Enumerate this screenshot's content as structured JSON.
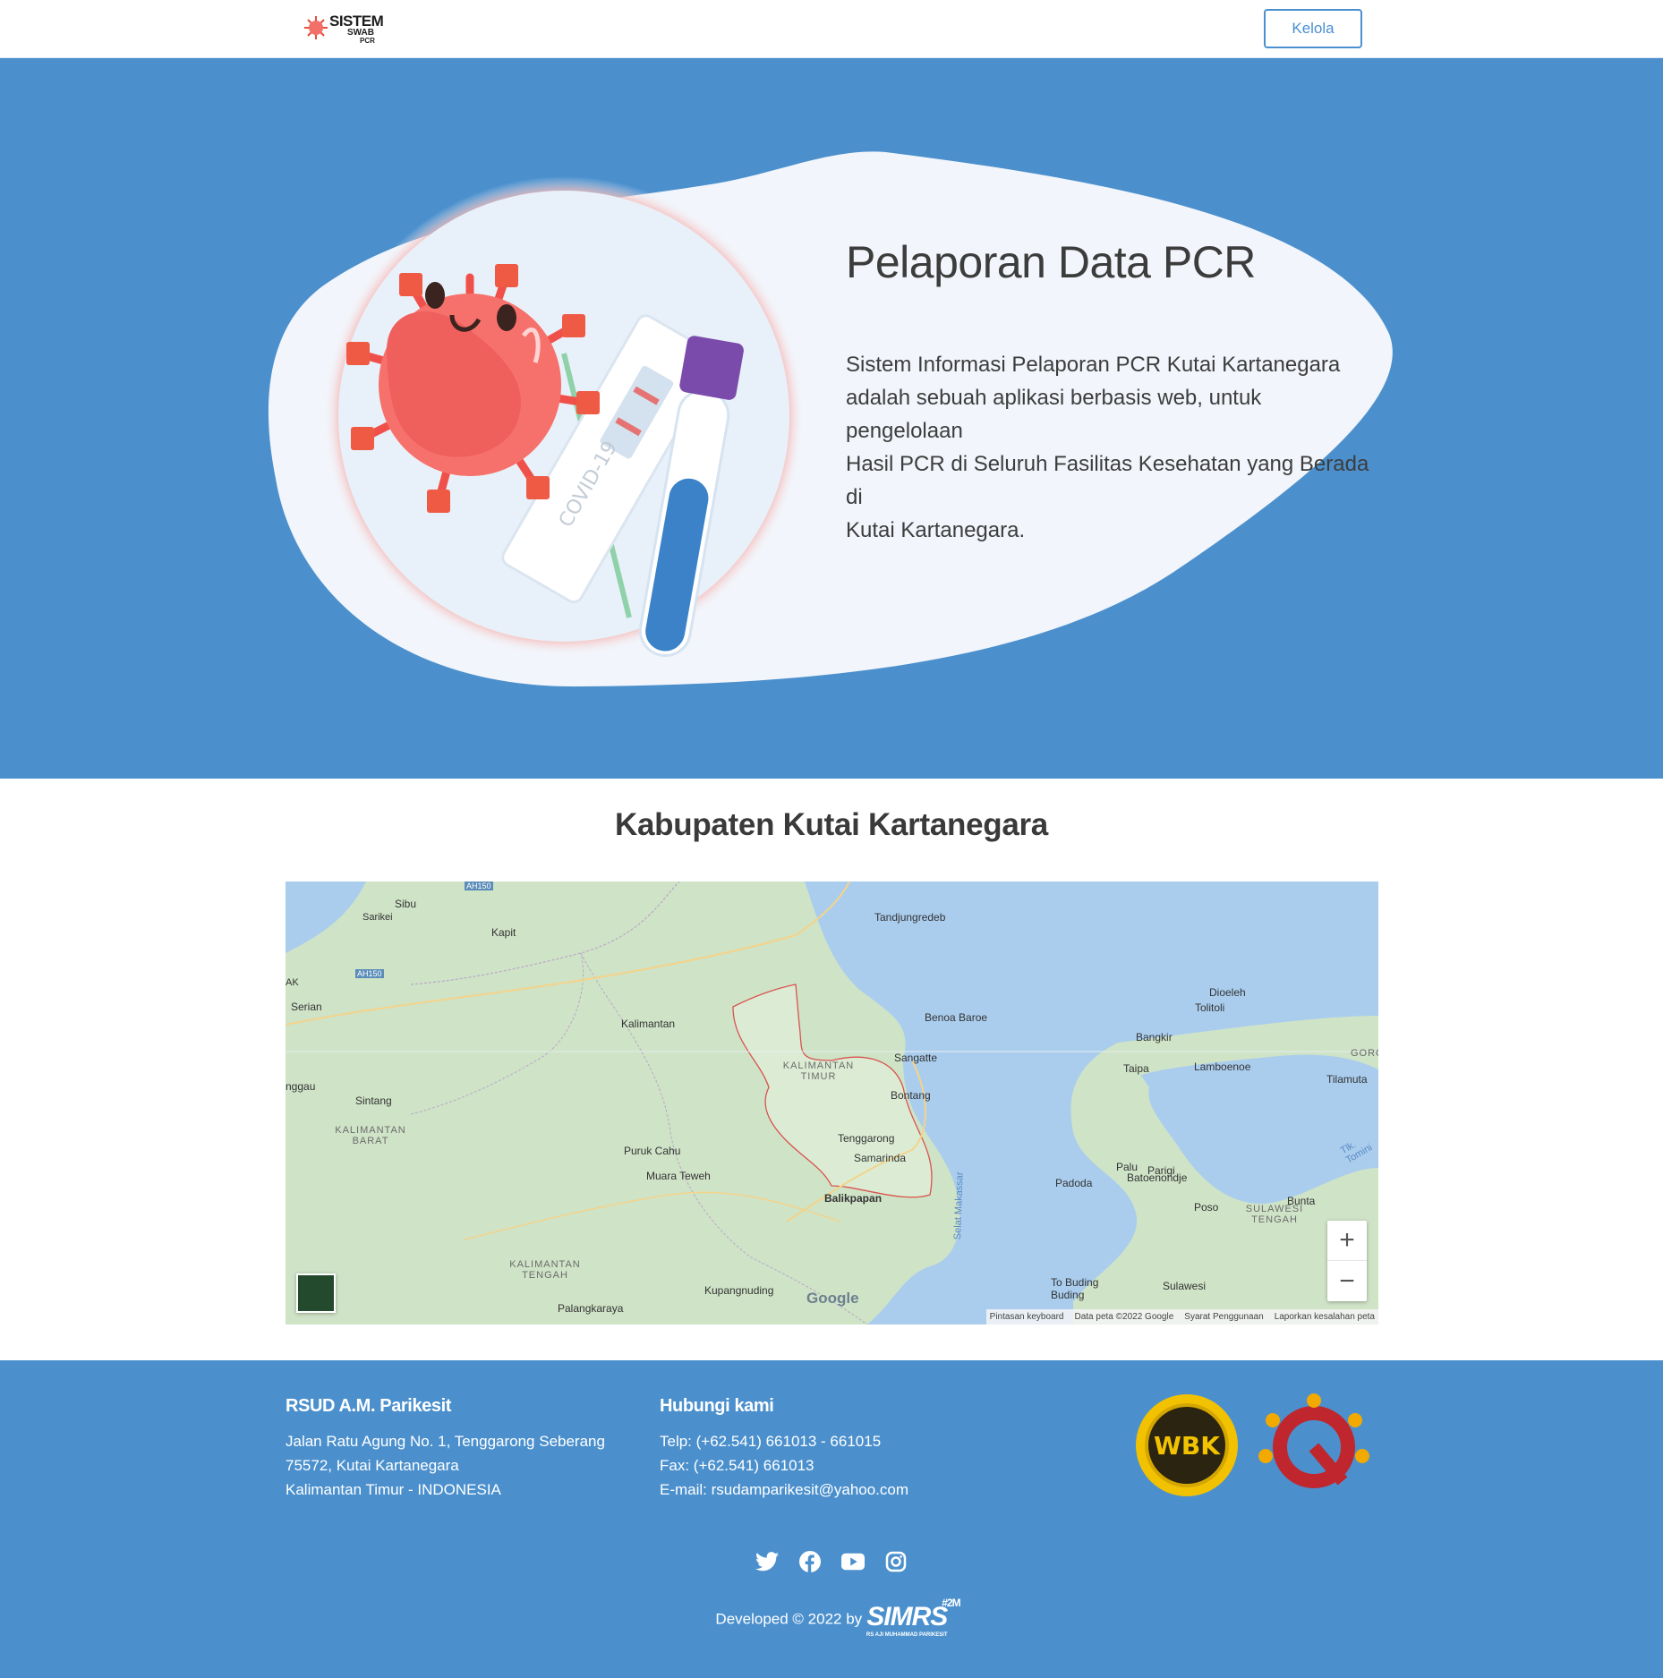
{
  "header": {
    "logo_line1": "SISTEM",
    "logo_line2": "SWAB",
    "logo_line3": "PCR",
    "kelola_label": "Kelola"
  },
  "hero": {
    "title": "Pelaporan Data PCR",
    "description_lines": [
      "Sistem Informasi Pelaporan PCR Kutai Kartanegara",
      "adalah sebuah aplikasi berbasis web, untuk pengelolaan",
      "Hasil PCR di Seluruh Fasilitas Kesehatan yang Berada",
      "di",
      "Kutai Kartanegara."
    ],
    "illustration_text": "COVID-19"
  },
  "map_section": {
    "title": "Kabupaten Kutai Kartanegara",
    "labels": [
      "Sibu",
      "Sarikei",
      "Kapit",
      "AH150",
      "AH150",
      "Tandjungredeb",
      "Serian",
      "Kalimantan",
      "Dioeleh",
      "Tolitoli",
      "Benoa Baroe",
      "Bangkir",
      "Sangatte",
      "KALIMANTAN TIMUR",
      "Taipa",
      "Lamboenoe",
      "GORONTA",
      "Tilamuta",
      "nggau",
      "Sintang",
      "Bontang",
      "KALIMANTAN BARAT",
      "Tenggarong",
      "Samarinda",
      "Puruk Cahu",
      "Muara Teweh",
      "Palu",
      "Parigi",
      "Balikpapan",
      "Padoda",
      "Batoenondje",
      "Bunta",
      "Poso",
      "SULAWESI TENGAH",
      "KALIMANTAN TENGAH",
      "Kupangnuding",
      "To Buding Buding",
      "Sulawesi",
      "Palangkaraya",
      "Tlk. Tomini",
      "Selat Makassar",
      "AK"
    ],
    "google_logo": "Google",
    "attribution": [
      "Pintasan keyboard",
      "Data peta ©2022 Google",
      "Syarat Penggunaan",
      "Laporkan kesalahan peta"
    ],
    "zoom_in": "+",
    "zoom_out": "−"
  },
  "footer": {
    "org_title": "RSUD A.M. Parikesit",
    "address_lines": [
      "Jalan Ratu Agung No. 1, Tenggarong Seberang",
      "75572, Kutai Kartanegara",
      "Kalimantan Timur - INDONESIA"
    ],
    "contact_title": "Hubungi kami",
    "contact_lines": [
      "Telp: (+62.541) 661013 - 661015",
      "Fax: (+62.541) 661013",
      "E-mail: rsudamparikesit@yahoo.com"
    ],
    "badge_wbk": "WBK",
    "social": [
      "twitter-icon",
      "facebook-icon",
      "youtube-icon",
      "instagram-icon"
    ],
    "credit_prefix": "Developed © 2022 by",
    "credit_brand": "SIMRS",
    "credit_sup": "#2M",
    "credit_sub": "RS AJI MUHAMMAD PARIKESIT"
  },
  "colors": {
    "primary": "#4b90cd",
    "blob": "#f2f5fb",
    "virus": "#f26f6a",
    "land": "#cfe3c7",
    "water": "#aacdee"
  }
}
